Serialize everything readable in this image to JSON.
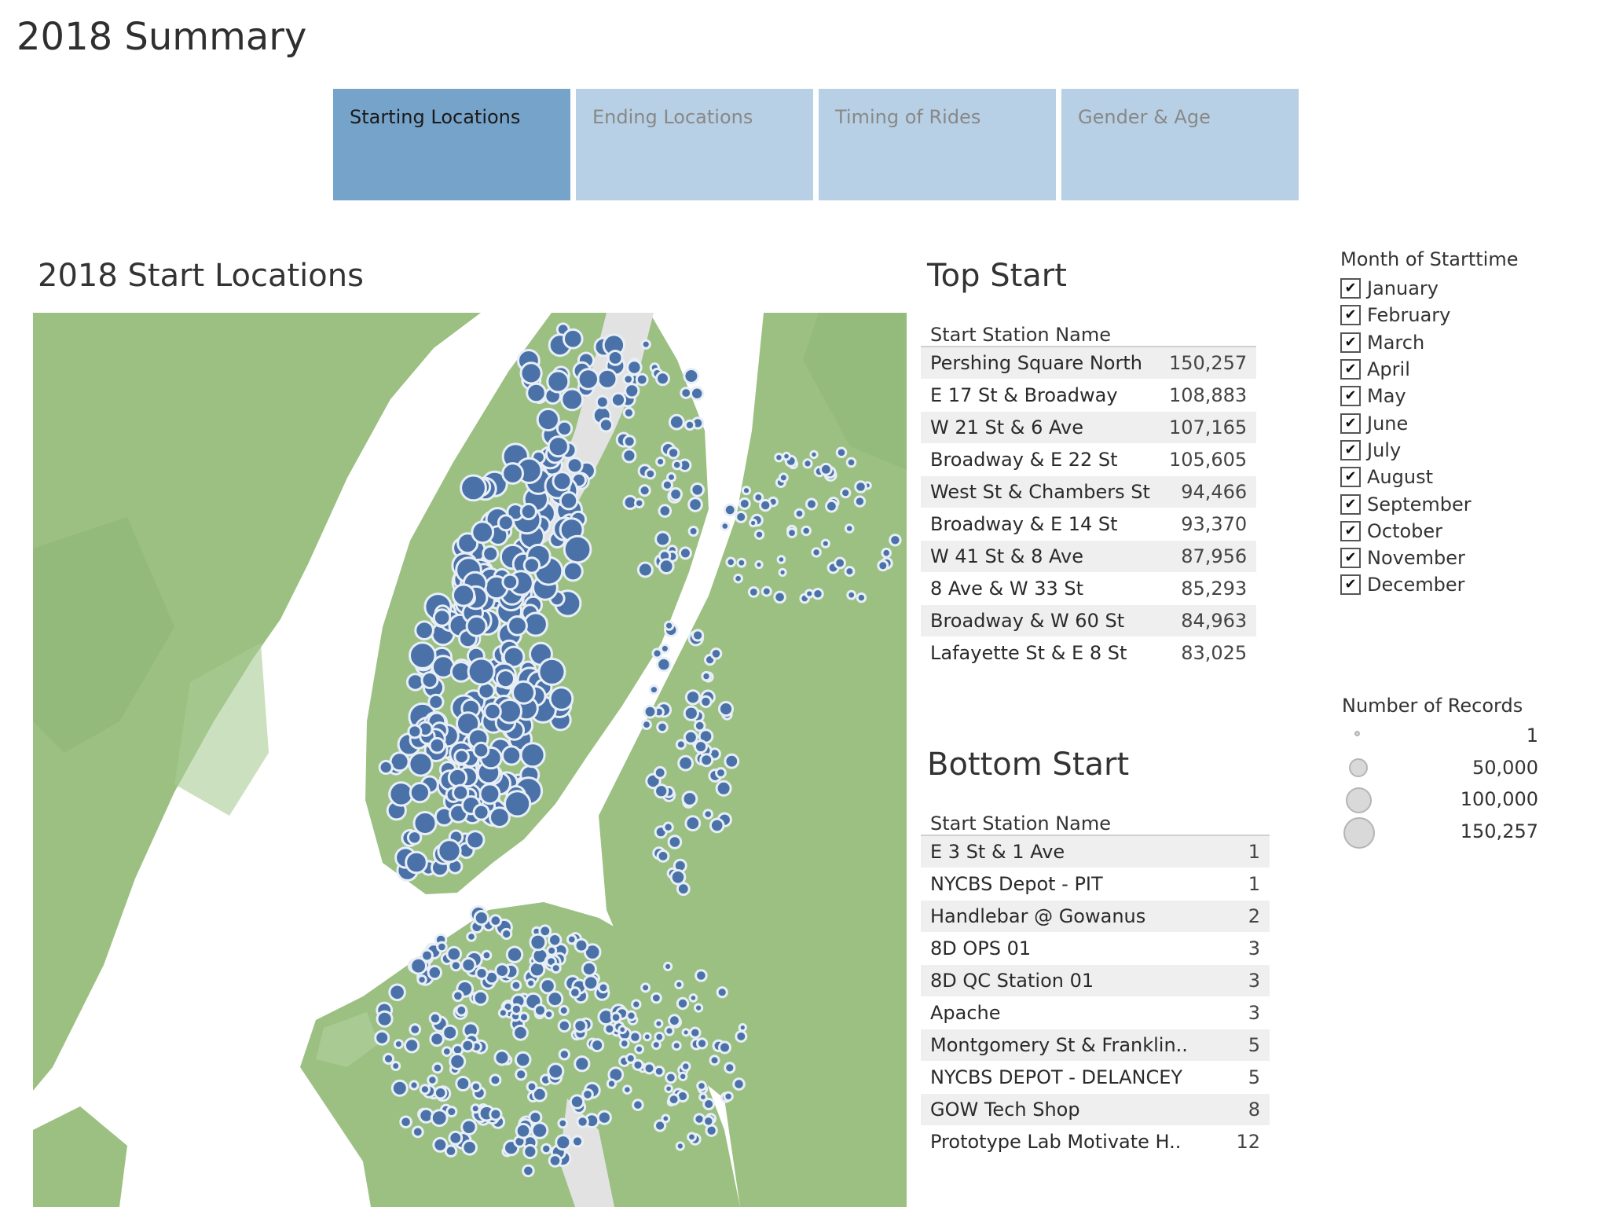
{
  "page": {
    "title": "2018 Summary"
  },
  "tabs": [
    {
      "label": "Starting Locations",
      "active": true
    },
    {
      "label": "Ending Locations",
      "active": false
    },
    {
      "label": "Timing of Rides",
      "active": false
    },
    {
      "label": "Gender & Age",
      "active": false
    }
  ],
  "map": {
    "title": "2018 Start Locations",
    "colors": {
      "land": "#9bc082",
      "land_dark": "#8db575",
      "water": "#ffffff",
      "park": "#e2e2e2",
      "marker": "#4a72a8",
      "marker_stroke": "#e8eef6"
    }
  },
  "top_start": {
    "title": "Top Start",
    "column_header": "Start Station Name",
    "rows": [
      {
        "name": "Pershing Square North",
        "value": "150,257"
      },
      {
        "name": "E 17 St & Broadway",
        "value": "108,883"
      },
      {
        "name": "W 21 St & 6 Ave",
        "value": "107,165"
      },
      {
        "name": "Broadway & E 22 St",
        "value": "105,605"
      },
      {
        "name": "West St & Chambers St",
        "value": "94,466"
      },
      {
        "name": "Broadway & E 14 St",
        "value": "93,370"
      },
      {
        "name": "W 41 St & 8 Ave",
        "value": "87,956"
      },
      {
        "name": "8 Ave & W 33 St",
        "value": "85,293"
      },
      {
        "name": "Broadway & W 60 St",
        "value": "84,963"
      },
      {
        "name": "Lafayette St & E 8 St",
        "value": "83,025"
      }
    ]
  },
  "bottom_start": {
    "title": "Bottom Start",
    "column_header": "Start Station Name",
    "rows": [
      {
        "name": "E 3 St & 1 Ave",
        "value": "1"
      },
      {
        "name": "NYCBS Depot - PIT",
        "value": "1"
      },
      {
        "name": "Handlebar @ Gowanus",
        "value": "2"
      },
      {
        "name": "8D OPS 01",
        "value": "3"
      },
      {
        "name": "8D QC Station 01",
        "value": "3"
      },
      {
        "name": "Apache",
        "value": "3"
      },
      {
        "name": "Montgomery St & Franklin..",
        "value": "5"
      },
      {
        "name": "NYCBS DEPOT - DELANCEY",
        "value": "5"
      },
      {
        "name": "GOW Tech Shop",
        "value": "8"
      },
      {
        "name": "Prototype Lab Motivate H..",
        "value": "12"
      }
    ]
  },
  "month_filter": {
    "title": "Month of Starttime",
    "check_glyph": "✔",
    "months": [
      "January",
      "February",
      "March",
      "April",
      "May",
      "June",
      "July",
      "August",
      "September",
      "October",
      "November",
      "December"
    ]
  },
  "size_legend": {
    "title": "Number of Records",
    "items": [
      {
        "label": "1",
        "value": 1
      },
      {
        "label": "50,000",
        "value": 50000
      },
      {
        "label": "100,000",
        "value": 100000
      },
      {
        "label": "150,257",
        "value": 150257
      }
    ]
  }
}
